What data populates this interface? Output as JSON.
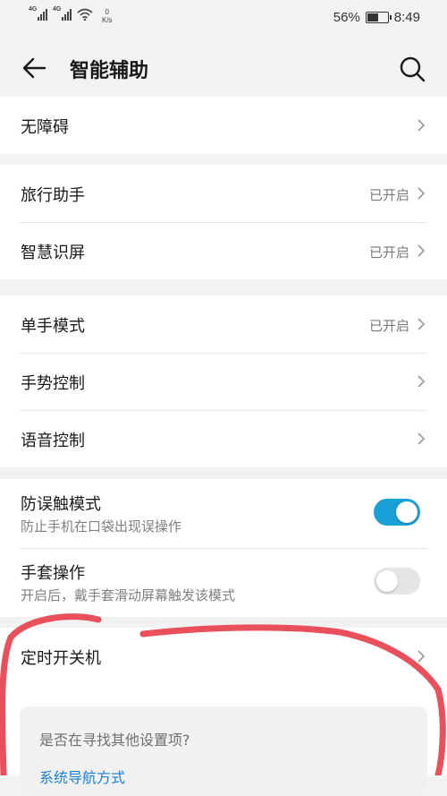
{
  "status_bar": {
    "signal1_tag": "4G",
    "signal2_tag": "4G",
    "net_speed_value": "0",
    "net_speed_unit": "K/s",
    "battery_percent": "56%",
    "battery_level": 0.56,
    "time": "8:49"
  },
  "header": {
    "title": "智能辅助"
  },
  "sections": {
    "accessibility": {
      "label": "无障碍"
    },
    "travel": {
      "label": "旅行助手",
      "value": "已开启"
    },
    "smart_screen": {
      "label": "智慧识屏",
      "value": "已开启"
    },
    "one_hand": {
      "label": "单手模式",
      "value": "已开启"
    },
    "gesture": {
      "label": "手势控制"
    },
    "voice": {
      "label": "语音控制"
    },
    "mistouch": {
      "label": "防误触模式",
      "sub": "防止手机在口袋出现误操作",
      "enabled": true
    },
    "glove": {
      "label": "手套操作",
      "sub": "开启后，戴手套滑动屏幕触发该模式",
      "enabled": false
    },
    "scheduled_power": {
      "label": "定时开关机"
    }
  },
  "suggest": {
    "question": "是否在寻找其他设置项?",
    "link": "系统导航方式"
  },
  "colors": {
    "accent": "#1aa0d8",
    "annotation": "#e8505b"
  }
}
